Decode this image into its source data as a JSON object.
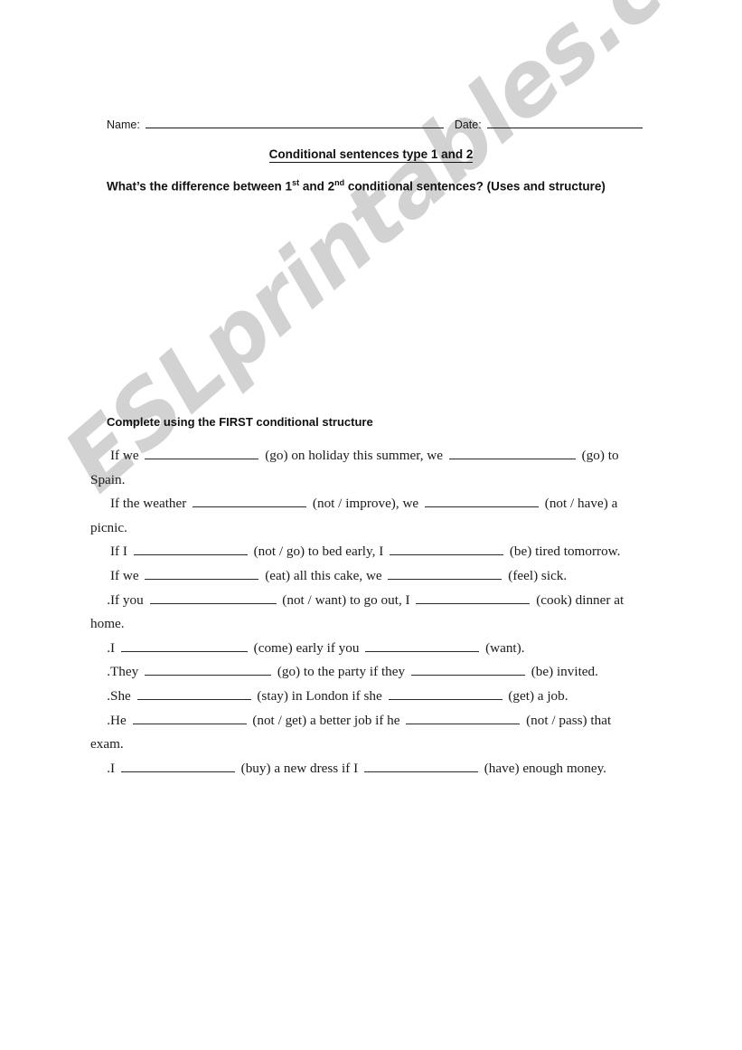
{
  "header": {
    "name_label": "Name:",
    "date_label": "Date:",
    "title": "Conditional sentences type 1 and 2",
    "prompt_before": "What’s the difference between ",
    "prompt_first_num": "1",
    "prompt_first_sup": "st",
    "prompt_middle": " and ",
    "prompt_second_num": "2",
    "prompt_second_sup": "nd",
    "prompt_after": " conditional sentences? (Uses and structure)"
  },
  "watermark": {
    "text": "ESLprintables.com",
    "color": "#d2d2d2"
  },
  "exercise": {
    "heading": "Complete using the FIRST conditional structure",
    "items": [
      {
        "number": "",
        "p1": "If we ",
        "p2": " (go) on holiday this summer, we ",
        "p3": " (go) to Spain."
      },
      {
        "number": "",
        "p1": "If the weather ",
        "p2": " (not / improve), we ",
        "p3": " (not / have) a picnic."
      },
      {
        "number": "",
        "p1": "If I ",
        "p2": " (not / go) to bed early, I ",
        "p3": " (be) tired tomorrow."
      },
      {
        "number": "",
        "p1": "If we ",
        "p2": " (eat) all this cake, we ",
        "p3": " (feel) sick."
      },
      {
        "number": ".",
        "p1": "If you ",
        "p2": " (not / want) to go out, I ",
        "p3": " (cook) dinner at home."
      },
      {
        "number": ".",
        "p1": "I ",
        "p2": " (come) early if you ",
        "p3": " (want)."
      },
      {
        "number": ".",
        "p1": "They ",
        "p2": " (go) to the party if they ",
        "p3": " (be) invited."
      },
      {
        "number": ".",
        "p1": "She ",
        "p2": " (stay) in London if she ",
        "p3": " (get) a job."
      },
      {
        "number": ".",
        "p1": "He ",
        "p2": " (not / get) a better job if he ",
        "p3": " (not / pass) that exam."
      },
      {
        "number": ".",
        "p1": "I ",
        "p2": " (buy) a new dress if I ",
        "p3": " (have) enough money."
      }
    ]
  }
}
